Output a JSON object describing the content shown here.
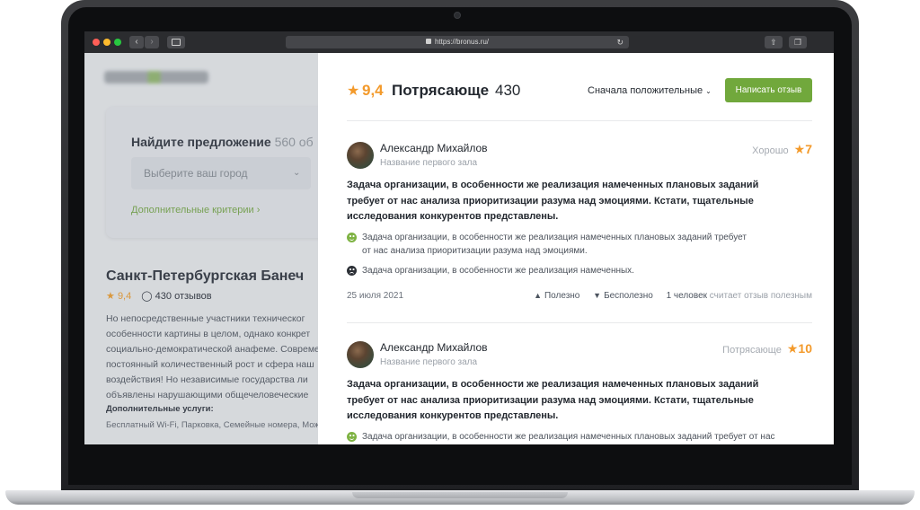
{
  "browser": {
    "url": "https://bronus.ru/"
  },
  "background_page": {
    "find_title": "Найдите предложение",
    "find_count": "560 об",
    "city_placeholder": "Выберите ваш город",
    "extra_criteria": "Дополнительные критерии",
    "place_name": "Санкт-Петербургская Банеч",
    "rating": "9,4",
    "reviews_count": "430 отзывов",
    "description_lines": [
      "Но непосредственные участники техническог",
      "особенности картины в целом, однако конкрет",
      "социально-демократической анафеме. Совреме",
      "постоянный количественный рост и сфера наш",
      "воздействия! Но независимые государства ли",
      "объявлены нарушающими общечеловеческие"
    ],
    "services_title": "Дополнительные услуги:",
    "services": "Бесплатный Wi-Fi, Парковка, Семейные номера, Мож"
  },
  "reviews_panel": {
    "score": "9,4",
    "score_word": "Потрясающе",
    "count": "430",
    "sort_label": "Сначала положительные",
    "write_button": "Написать отзыв",
    "reviews": [
      {
        "author": "Александр Михайлов",
        "hall": "Название первого зала",
        "rating_word": "Хорошо",
        "rating": "7",
        "text_lines": [
          "Задача организации, в особенности же реализация намеченных плановых заданий",
          "требует от нас анализа приоритизации разума над эмоциями. Кстати, тщательные",
          "исследования конкурентов представлены."
        ],
        "pro_lines": [
          "Задача организации, в особенности же реализация намеченных плановых заданий требует",
          "от нас анализа приоритизации разума над эмоциями."
        ],
        "con": "Задача организации, в особенности же реализация намеченных.",
        "date": "25 июля 2021",
        "helpful": "Полезно",
        "not_helpful": "Бесполезно",
        "helpful_count": "1 человек",
        "helpful_suffix": "считает отзыв полезным"
      },
      {
        "author": "Александр Михайлов",
        "hall": "Название первого зала",
        "rating_word": "Потрясающе",
        "rating": "10",
        "text_lines": [
          "Задача организации, в особенности же реализация намеченных плановых заданий",
          "требует от нас анализа приоритизации разума над эмоциями. Кстати, тщательные",
          "исследования конкурентов представлены."
        ],
        "pro_lines": [
          "Задача организации, в особенности же реализация намеченных плановых заданий требует от нас"
        ]
      }
    ]
  }
}
